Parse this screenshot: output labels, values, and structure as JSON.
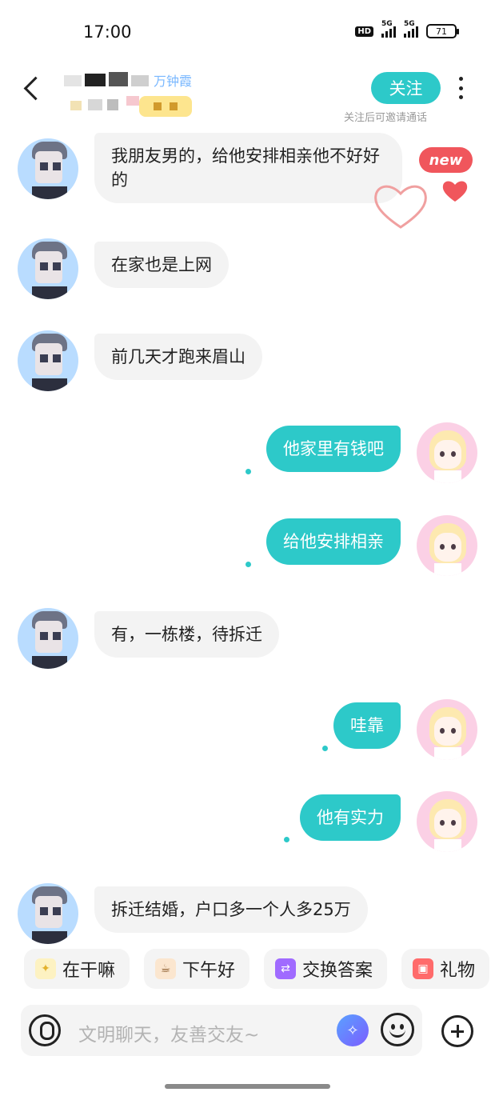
{
  "status_bar": {
    "time": "17:00",
    "hd_label": "HD",
    "net1": "5G",
    "net2": "5G",
    "battery": "71"
  },
  "header": {
    "follow_label": "关注",
    "follow_hint": "关注后可邀请通话",
    "name_tail": "万钟霞"
  },
  "new_badge": "new",
  "messages": [
    {
      "side": "in",
      "text": "我朋友男的，给他安排相亲他不好好的"
    },
    {
      "side": "in",
      "text": "在家也是上网"
    },
    {
      "side": "in",
      "text": "前几天才跑来眉山"
    },
    {
      "side": "out",
      "text": "他家里有钱吧"
    },
    {
      "side": "out",
      "text": "给他安排相亲"
    },
    {
      "side": "in",
      "text": "有，一栋楼，待拆迁"
    },
    {
      "side": "out",
      "text": "哇靠"
    },
    {
      "side": "out",
      "text": "他有实力"
    },
    {
      "side": "in",
      "text": "拆迁结婚，户口多一个人多25万"
    }
  ],
  "quick_replies": [
    {
      "label": "在干嘛",
      "icon": "sparkle-icon"
    },
    {
      "label": "下午好",
      "icon": "coffee-icon"
    },
    {
      "label": "交换答案",
      "icon": "swap-icon"
    },
    {
      "label": "礼物",
      "icon": "gift-icon"
    }
  ],
  "input": {
    "placeholder": "文明聊天，友善交友~"
  },
  "colors": {
    "accent": "#2dc9c9",
    "badge": "#f0565c",
    "incoming_bubble": "#f3f3f3"
  }
}
